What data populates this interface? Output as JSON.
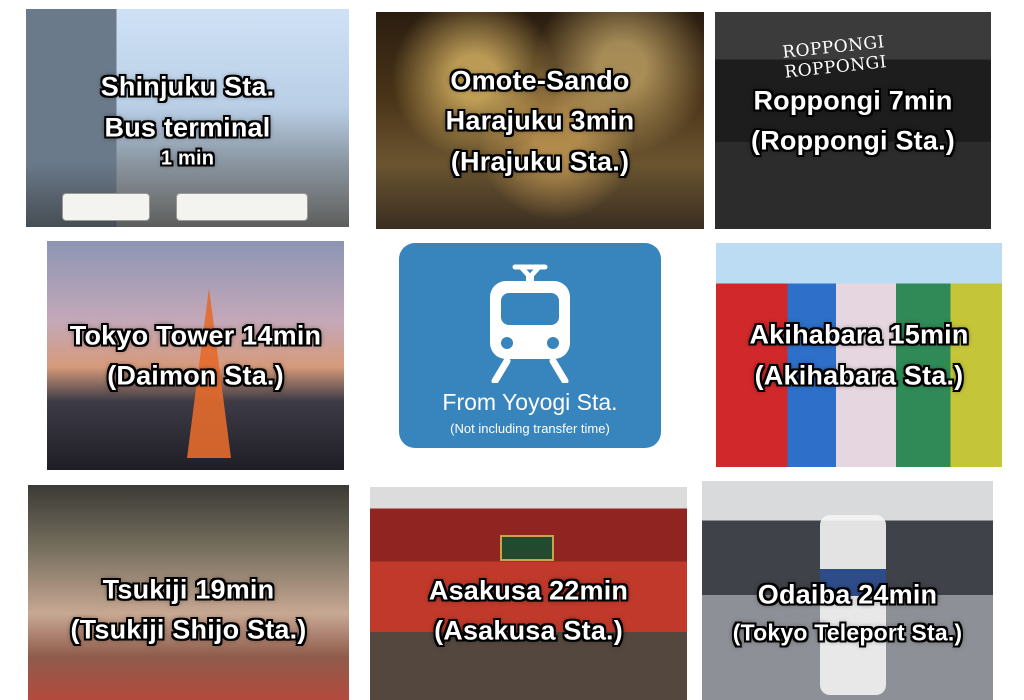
{
  "tiles": [
    {
      "id": "shinjuku",
      "lines": [
        "Shinjuku Sta.",
        "Bus terminal",
        "1 min"
      ]
    },
    {
      "id": "omotesando",
      "lines": [
        "Omote-Sando",
        "Harajuku 3min",
        "(Hrajuku Sta.)"
      ]
    },
    {
      "id": "roppongi",
      "lines": [
        "Roppongi 7min",
        "(Roppongi Sta.)"
      ],
      "sign": "ROPPONGI ROPPONGI"
    },
    {
      "id": "tokyotower",
      "lines": [
        "Tokyo Tower 14min",
        "(Daimon Sta.)"
      ]
    },
    {
      "id": "akihabara",
      "lines": [
        "Akihabara 15min",
        "(Akihabara Sta.)"
      ]
    },
    {
      "id": "tsukiji",
      "lines": [
        "Tsukiji 19min",
        "(Tsukiji Shijo Sta.)"
      ]
    },
    {
      "id": "asakusa",
      "lines": [
        "Asakusa 22min",
        "(Asakusa Sta.)"
      ]
    },
    {
      "id": "odaiba",
      "lines": [
        "Odaiba 24min",
        "(Tokyo Teleport Sta.)"
      ]
    }
  ],
  "info_card": {
    "icon": "train-icon",
    "title": "From Yoyogi Sta.",
    "note": "(Not including transfer time)",
    "color": "#3884bd"
  }
}
